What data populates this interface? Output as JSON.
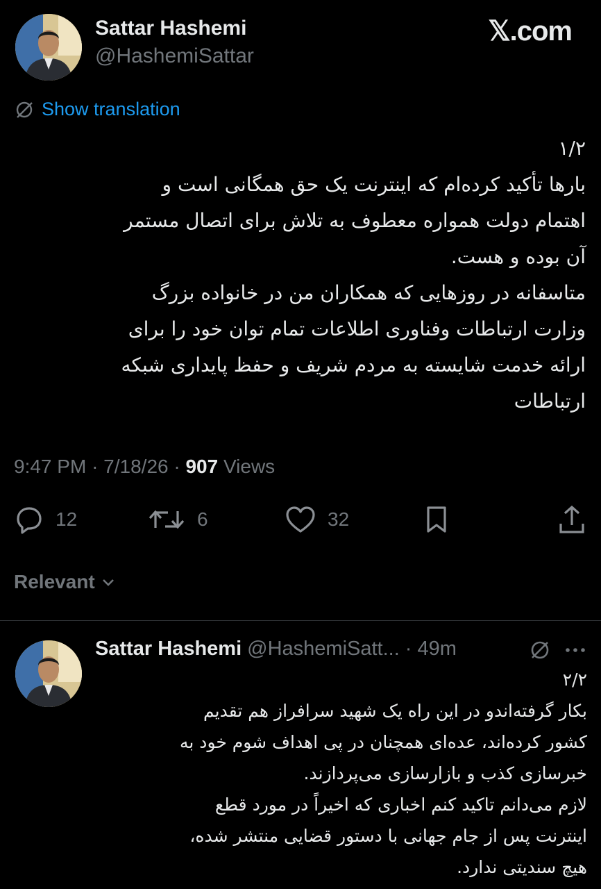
{
  "brand": "𝕏.com",
  "author": {
    "name": "Sattar Hashemi",
    "handle": "@HashemiSattar"
  },
  "translation_label": "Show translation",
  "tweet": {
    "lines": [
      "۱/۲",
      "بارها تأکید کرده‌ام که اینترنت یک حق همگانی است و",
      "اهتمام دولت همواره معطوف به تلاش برای اتصال مستمر",
      "آن بوده و هست.",
      "متاسفانه در روزهایی که همکاران من در خانواده بزرگ",
      "وزارت ارتباطات وفناوری اطلاعات تمام توان خود را برای",
      "ارائه خدمت شایسته به مردم شریف و حفظ پایداری شبکه",
      "ارتباطات"
    ],
    "time": "9:47 PM",
    "date": "7/18/26",
    "separator": "·",
    "views_count": "907",
    "views_label": "Views"
  },
  "actions": {
    "replies": "12",
    "reposts": "6",
    "likes": "32"
  },
  "sort_label": "Relevant",
  "reply": {
    "name": "Sattar Hashemi",
    "handle": "@HashemiSatt...",
    "separator": "·",
    "time": "49m",
    "lines": [
      "۲/۲",
      "بکار گرفته‌اندو در این راه یک شهید سرافراز هم تقدیم",
      "کشور کرده‌اند، عده‌ای همچنان در پی اهداف شوم خود به",
      "خبرسازی کذب و بازارسازی می‌پردازند.",
      "لازم می‌دانم تاکید کنم اخباری که اخیراً در مورد قطع",
      "اینترنت پس از جام جهانی با دستور قضایی منتشر شده،",
      "هیچ سندیتی ندارد."
    ]
  },
  "colors": {
    "background": "#000000",
    "text": "#e7e9ea",
    "muted": "#71767b",
    "link": "#1d9bf0",
    "divider": "#2f3336"
  }
}
